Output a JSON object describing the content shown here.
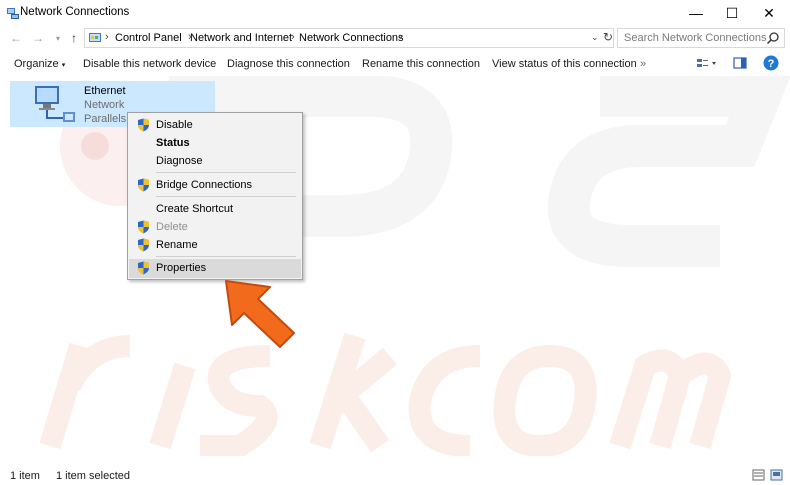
{
  "window": {
    "title": "Network Connections",
    "minimize": "—",
    "maximize": "☐",
    "close": "✕"
  },
  "address": {
    "crumbs": [
      "Control Panel",
      "Network and Internet",
      "Network Connections"
    ],
    "search_placeholder": "Search Network Connections"
  },
  "commands": {
    "organize": "Organize",
    "disable": "Disable this network device",
    "diagnose": "Diagnose this connection",
    "rename": "Rename this connection",
    "view_status": "View status of this connection",
    "more": "»"
  },
  "item": {
    "name": "Ethernet",
    "line2": "Network",
    "line3": "Parallels E"
  },
  "context_menu": {
    "disable": "Disable",
    "status": "Status",
    "diagnose": "Diagnose",
    "bridge": "Bridge Connections",
    "create_shortcut": "Create Shortcut",
    "delete": "Delete",
    "rename": "Rename",
    "properties": "Properties"
  },
  "status": {
    "count": "1 item",
    "selected": "1 item selected"
  },
  "colors": {
    "selection": "#cce8ff",
    "arrow": "#f26b1d",
    "help": "#1e78d6"
  }
}
